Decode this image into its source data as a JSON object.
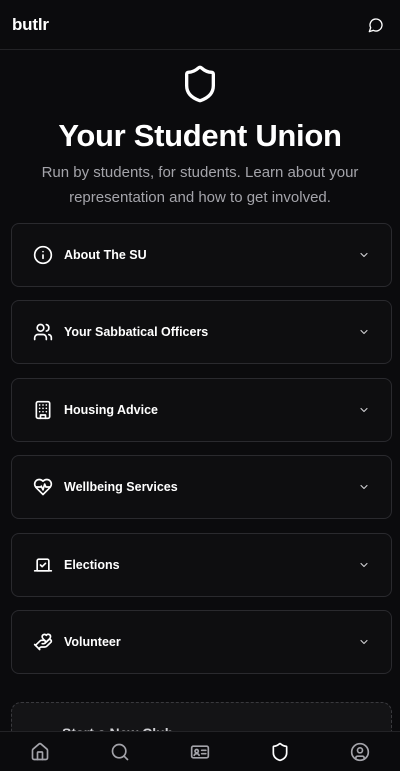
{
  "app": {
    "brand": "butlr"
  },
  "hero": {
    "icon": "shield-icon",
    "title": "Your Student Union",
    "subtitle": "Run by students, for students. Learn about your representation and how to get involved."
  },
  "sections": [
    {
      "icon": "info-icon",
      "label": "About The SU"
    },
    {
      "icon": "users-icon",
      "label": "Your Sabbatical Officers"
    },
    {
      "icon": "building-icon",
      "label": "Housing Advice"
    },
    {
      "icon": "heart-pulse-icon",
      "label": "Wellbeing Services"
    },
    {
      "icon": "ballot-icon",
      "label": "Elections"
    },
    {
      "icon": "hand-heart-icon",
      "label": "Volunteer"
    }
  ],
  "partial_card": {
    "label": "Start a New Club"
  },
  "bottom_nav": [
    {
      "icon": "home-icon"
    },
    {
      "icon": "search-icon"
    },
    {
      "icon": "id-card-icon"
    },
    {
      "icon": "shield-icon"
    },
    {
      "icon": "profile-icon"
    }
  ],
  "colors": {
    "background": "#0b0b0d",
    "card_border": "#2a2a2e",
    "muted_text": "#a4a4aa"
  }
}
